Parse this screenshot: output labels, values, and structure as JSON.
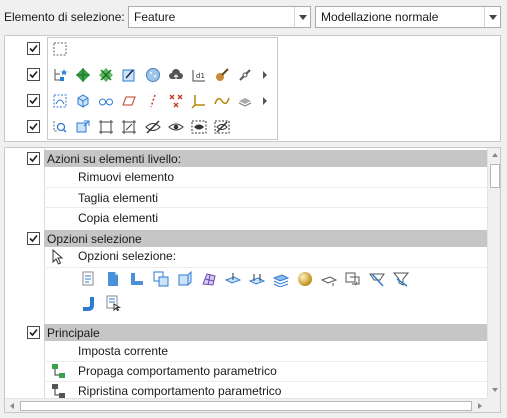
{
  "selection": {
    "label": "Elemento di selezione:",
    "filter_value": "Feature",
    "mode_value": "Modellazione normale"
  },
  "filter_rows": [
    {
      "checked": true,
      "icons": [
        "select-box-icon"
      ]
    },
    {
      "checked": true,
      "icons": [
        "tree-star-icon",
        "diamond-green-icon",
        "diamond-cross-icon",
        "sketch-plane-icon",
        "sphere-dots-icon",
        "cloud-upload-icon",
        "dimension-icon",
        "paint-brush-icon",
        "chain-link-icon"
      ]
    },
    {
      "checked": true,
      "icons": [
        "dashed-curve-icon",
        "cube-icon",
        "glasses-icon",
        "parallelogram-icon",
        "dashed-line-icon",
        "cross-points-icon",
        "axis-icon",
        "spline-icon",
        "layer-stack-icon"
      ]
    },
    {
      "checked": true,
      "icons": [
        "magnifier-select-icon",
        "arrow-box-icon",
        "frame-select-icon",
        "frame-hatch-icon",
        "hide-eye-icon",
        "eye-icon",
        "eye-box-icon",
        "eye-box-slash-icon"
      ]
    }
  ],
  "sections": {
    "azioni": {
      "label": "Azioni su elementi livello:",
      "checked": true,
      "items": [
        "Rimuovi elemento",
        "Taglia elementi",
        "Copia elementi"
      ]
    },
    "opzioni": {
      "label": "Opzioni selezione",
      "checked": true,
      "sublabel": "Opzioni selezione:",
      "icons": [
        "doc-list-icon",
        "blue-doc-icon",
        "blue-corner-icon",
        "copy-squares-icon",
        "blue-cube-icon",
        "grid-shape-icon",
        "plane-arrow-icon",
        "plane-arrows-icon",
        "mesh-block-icon",
        "gold-sphere-icon",
        "plane-flat-icon",
        "doc-arrow-icon",
        "plane-slash-icon",
        "funnel-arrow-icon",
        "blue-pipe-icon",
        "doc-select-icon"
      ]
    },
    "principale": {
      "label": "Principale",
      "checked": true,
      "items": [
        "Imposta corrente",
        "Propaga comportamento parametrico",
        "Ripristina comportamento parametrico"
      ]
    }
  },
  "colors": {
    "section_header": "#c6c6c6",
    "blue_icon": "#2e7bd6",
    "green_icon": "#3aa04a"
  }
}
